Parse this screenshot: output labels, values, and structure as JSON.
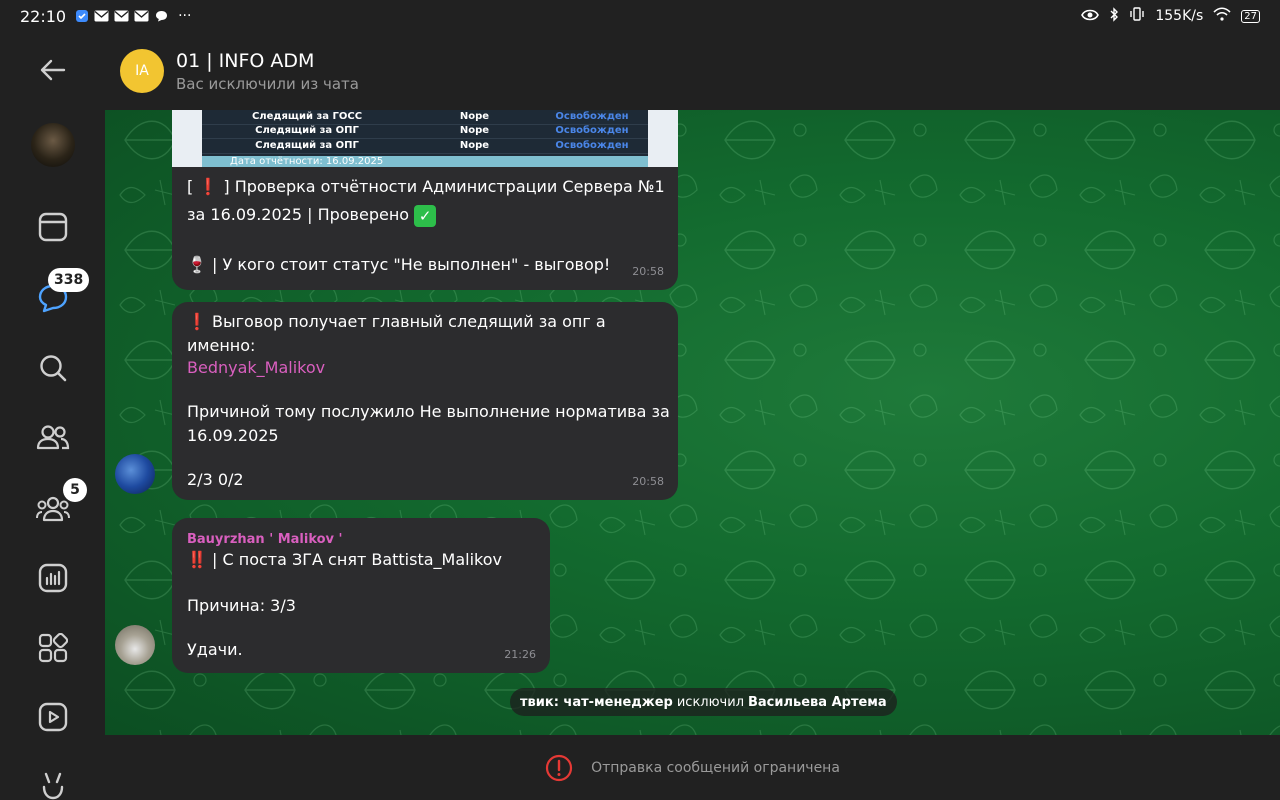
{
  "status_bar": {
    "time": "22:10",
    "notif_dots": "···",
    "net_speed": "155K/s",
    "battery": "27"
  },
  "rail": {
    "chats_badge": "338",
    "groups_badge": "5"
  },
  "header": {
    "avatar_initials": "IA",
    "title": "01 | INFO ADM",
    "subtitle": "Вас исключили из чата"
  },
  "messages": {
    "m1": {
      "table_rows": [
        {
          "role": "Следящий за ГОСС",
          "value": "Nope",
          "status": "Освобожден"
        },
        {
          "role": "Следящий за ОПГ",
          "value": "Nope",
          "status": "Освобожден"
        },
        {
          "role": "Следящий за ОПГ",
          "value": "Nope",
          "status": "Освобожден"
        }
      ],
      "table_footer": "Дата отчётности: 16.09.2025",
      "line1_open": "[",
      "line1_mark": "❗",
      "line1_text": "] Проверка отчётности Администрации Сервера №1",
      "line2_text": "за 16.09.2025 | Проверено",
      "check_mark": "✓",
      "line3_emoji": "🍷",
      "line3_text": "| У кого стоит статус \"Не выполнен\" - выговор!",
      "time": "20:58"
    },
    "m2": {
      "mark": "❗",
      "line1": "Выговор получает главный следящий за опг а именно:",
      "mention": "Bednyak_Malikov",
      "line3": "Причиной тому послужило Не выполнение норматива за",
      "line4": "16.09.2025",
      "line5": "2/3 0/2",
      "time": "20:58"
    },
    "m3": {
      "sender": "Bauyrzhan ' Malikov '",
      "mark": "‼️",
      "line1": "| С поста ЗГА снят Battista_Malikov",
      "line2": "Причина: 3/3",
      "line3": "Удачи.",
      "time": "21:26"
    }
  },
  "service": {
    "actor": "твик: чат-менеджер",
    "action": "исключил",
    "target": "Васильева Артема"
  },
  "bottom": {
    "restricted_text": "Отправка сообщений ограничена"
  },
  "colors": {
    "accent_link": "#d95fbf",
    "bubble": "#2c2c2e",
    "chat_bg": "#136b2f",
    "avatar_yellow": "#f2c531"
  }
}
